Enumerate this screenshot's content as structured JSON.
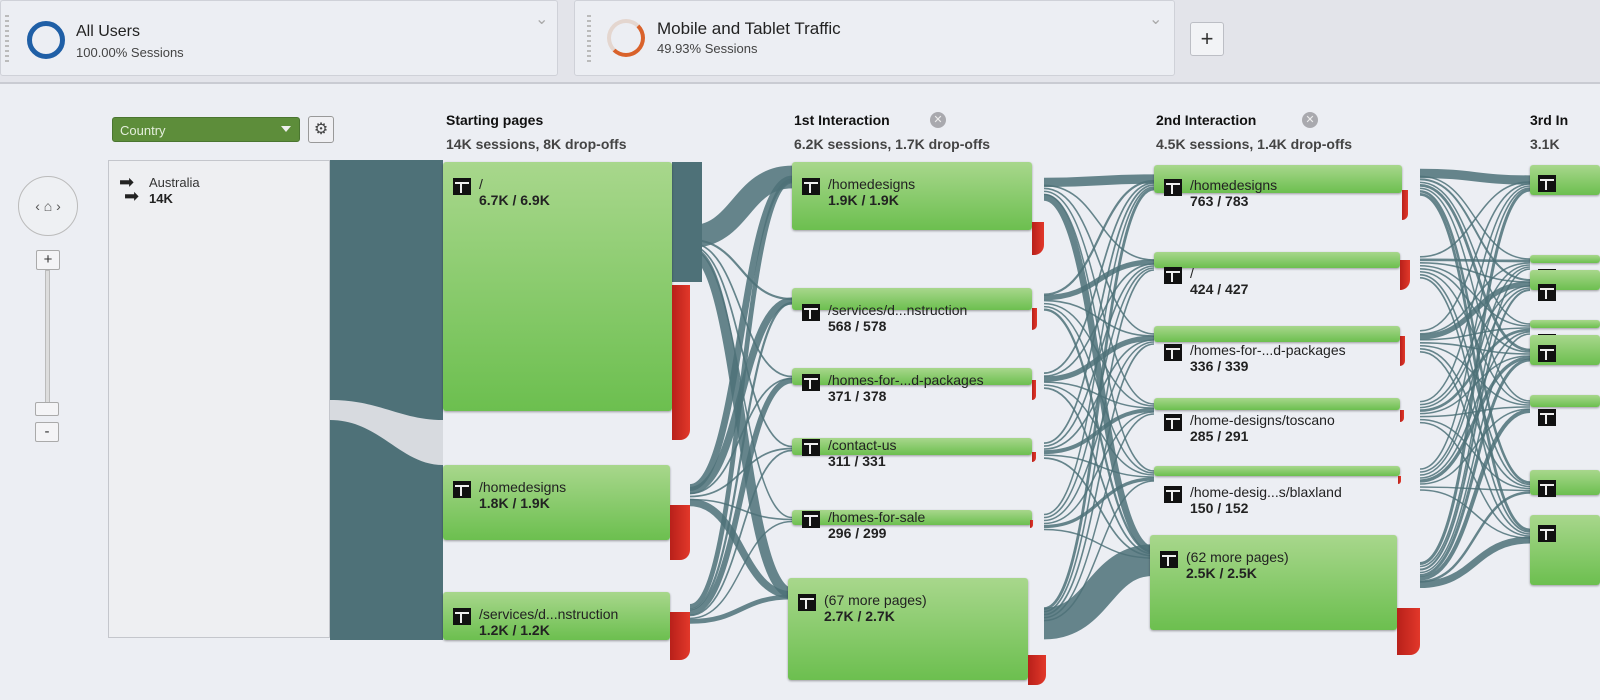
{
  "segments": [
    {
      "name": "All Users",
      "sessions": "100.00% Sessions",
      "color": "#1f5fa6"
    },
    {
      "name": "Mobile and Tablet Traffic",
      "sessions": "49.93% Sessions",
      "color": "#d9622b"
    }
  ],
  "add_segment_icon": "+",
  "dimension_dropdown": {
    "selected": "Country"
  },
  "settings_icon": "⚙",
  "zoom": {
    "home_icon": "‹ ⌂ ›",
    "plus": "+",
    "minus": "-"
  },
  "country_node": {
    "name": "Australia",
    "value": "14K"
  },
  "colors": {
    "node": "#6cbf4f",
    "dropoff": "#d9302a",
    "flow": "#4e7178",
    "dropdown": "#5d8d3a"
  },
  "columns": [
    {
      "title": "Starting pages",
      "summary": "14K sessions, 8K drop-offs",
      "nodes": [
        {
          "page": "/",
          "value": "6.7K / 6.9K"
        },
        {
          "page": "/homedesigns",
          "value": "1.8K / 1.9K"
        },
        {
          "page": "/services/d...nstruction",
          "value": "1.2K / 1.2K"
        }
      ]
    },
    {
      "title": "1st Interaction",
      "summary": "6.2K sessions, 1.7K drop-offs",
      "nodes": [
        {
          "page": "/homedesigns",
          "value": "1.9K / 1.9K"
        },
        {
          "page": "/services/d...nstruction",
          "value": "568 / 578"
        },
        {
          "page": "/homes-for-...d-packages",
          "value": "371 / 378"
        },
        {
          "page": "/contact-us",
          "value": "311 / 331"
        },
        {
          "page": "/homes-for-sale",
          "value": "296 / 299"
        },
        {
          "page": "(67 more pages)",
          "value": "2.7K / 2.7K"
        }
      ]
    },
    {
      "title": "2nd Interaction",
      "summary": "4.5K sessions, 1.4K drop-offs",
      "nodes": [
        {
          "page": "/homedesigns",
          "value": "763 / 783"
        },
        {
          "page": "/",
          "value": "424 / 427"
        },
        {
          "page": "/homes-for-...d-packages",
          "value": "336 / 339"
        },
        {
          "page": "/home-designs/toscano",
          "value": "285 / 291"
        },
        {
          "page": "/home-desig...s/blaxland",
          "value": "150 / 152"
        },
        {
          "page": "(62 more pages)",
          "value": "2.5K / 2.5K"
        }
      ]
    },
    {
      "title": "3rd In",
      "summary": "3.1K"
    }
  ]
}
